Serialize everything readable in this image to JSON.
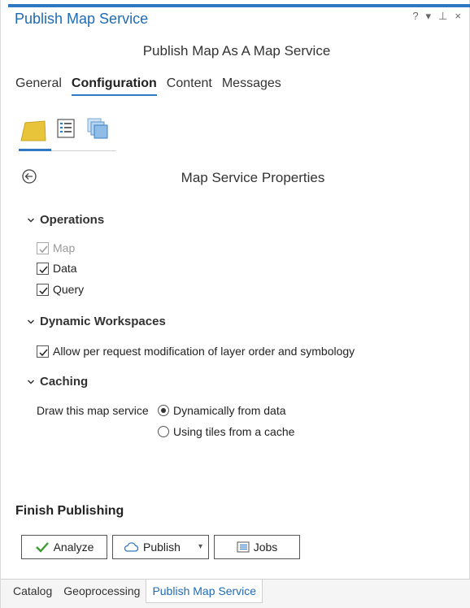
{
  "window": {
    "title": "Publish Map Service",
    "controls": {
      "help": "?",
      "menu": "▾",
      "pin": "⊥",
      "close": "×"
    }
  },
  "subtitle": "Publish Map As A Map Service",
  "tabs": [
    {
      "label": "General",
      "active": false
    },
    {
      "label": "Configuration",
      "active": true
    },
    {
      "label": "Content",
      "active": false
    },
    {
      "label": "Messages",
      "active": false
    }
  ],
  "subtabs": [
    {
      "icon": "map-folder-icon",
      "active": true
    },
    {
      "icon": "list-properties-icon",
      "active": false
    },
    {
      "icon": "stacked-layers-icon",
      "active": false
    }
  ],
  "section_title": "Map Service Properties",
  "operations": {
    "header": "Operations",
    "items": [
      {
        "label": "Map",
        "checked": true,
        "disabled": true
      },
      {
        "label": "Data",
        "checked": true,
        "disabled": false
      },
      {
        "label": "Query",
        "checked": true,
        "disabled": false
      }
    ]
  },
  "dynamic_workspaces": {
    "header": "Dynamic Workspaces",
    "items": [
      {
        "label": "Allow per request modification of layer order and symbology",
        "checked": true
      }
    ]
  },
  "caching": {
    "header": "Caching",
    "draw_label": "Draw this map service",
    "options": [
      {
        "label": "Dynamically from data",
        "selected": true
      },
      {
        "label": "Using tiles from a cache",
        "selected": false
      }
    ]
  },
  "finish": {
    "header": "Finish Publishing",
    "analyze_label": "Analyze",
    "publish_label": "Publish",
    "jobs_label": "Jobs"
  },
  "bottom_tabs": [
    {
      "label": "Catalog",
      "active": false
    },
    {
      "label": "Geoprocessing",
      "active": false
    },
    {
      "label": "Publish Map Service",
      "active": true
    }
  ],
  "colors": {
    "accent": "#2f79c4",
    "title": "#1f6bb5",
    "folder_yellow": "#e8c43a",
    "check_green": "#3a9a2f"
  }
}
